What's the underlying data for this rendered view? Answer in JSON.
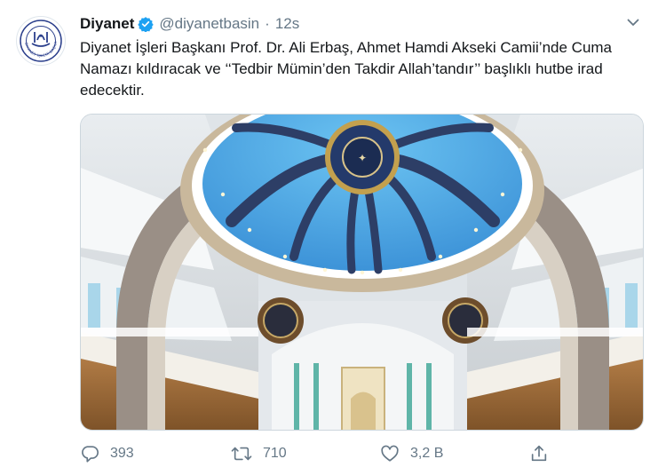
{
  "tweet": {
    "display_name": "Diyanet",
    "handle": "@diyanetbasin",
    "separator": "·",
    "time": "12s",
    "text": "Diyanet İşleri Başkanı Prof. Dr. Ali Erbaş, Ahmet Hamdi Akseki Camii’nde Cuma Namazı kıldıracak ve ‘‘Tedbir Mümin’den Takdir Allah’tandır’’ başlıklı hutbe irad edecektir."
  },
  "avatar": {
    "logo_text": "DİYANET İŞLERİ BAŞKANLIĞI"
  },
  "actions": {
    "reply_count": "393",
    "retweet_count": "710",
    "like_count": "3,2 B"
  },
  "icons": {
    "verified": "verified-badge-icon",
    "more": "chevron-down-icon",
    "reply": "reply-icon",
    "retweet": "retweet-icon",
    "like": "heart-icon",
    "share": "share-icon"
  },
  "colors": {
    "text": "#14171a",
    "secondary": "#657786",
    "verified": "#1da1f2",
    "border": "#ccd6dd",
    "logo": "#2b3f8c"
  }
}
